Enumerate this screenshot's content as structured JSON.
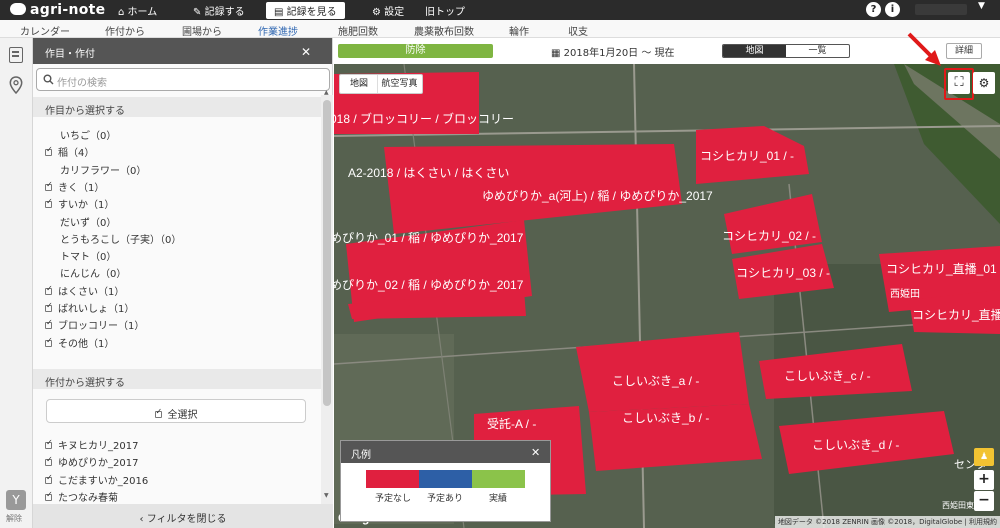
{
  "app": {
    "name": "agri-note"
  },
  "topnav": {
    "home": "ホーム",
    "record": "記録する",
    "view_record": "記録を見る",
    "settings": "設定",
    "legacy": "旧トップ",
    "help": "?",
    "info": "i"
  },
  "tabs": [
    "カレンダー",
    "作付から",
    "圃場から",
    "作業進捗",
    "施肥回数",
    "農薬散布回数",
    "輪作",
    "収支"
  ],
  "active_tab": "作業進捗",
  "panel": {
    "title": "作目・作付",
    "search_placeholder": "作付の検索",
    "crops_section": "作目から選択する",
    "crops": [
      {
        "label": "いちご（0）",
        "checked": false
      },
      {
        "label": "稲（4）",
        "checked": true
      },
      {
        "label": "カリフラワー（0）",
        "checked": false
      },
      {
        "label": "きく（1）",
        "checked": true
      },
      {
        "label": "すいか（1）",
        "checked": true
      },
      {
        "label": "だいず（0）",
        "checked": false
      },
      {
        "label": "とうもろこし（子実）（0）",
        "checked": false
      },
      {
        "label": "トマト（0）",
        "checked": false
      },
      {
        "label": "にんじん（0）",
        "checked": false
      },
      {
        "label": "はくさい（1）",
        "checked": true
      },
      {
        "label": "ばれいしょ（1）",
        "checked": true
      },
      {
        "label": "ブロッコリー（1）",
        "checked": true
      },
      {
        "label": "その他（1）",
        "checked": true
      }
    ],
    "plantings_section": "作付から選択する",
    "select_all": "全選択",
    "plantings": [
      {
        "label": "キヌヒカリ_2017",
        "checked": true
      },
      {
        "label": "ゆめぴりか_2017",
        "checked": true
      },
      {
        "label": "こだますいか_2016",
        "checked": true
      },
      {
        "label": "たつなみ春菊",
        "checked": true
      }
    ],
    "close_filter": "フィルタを閉じる",
    "release": "解除"
  },
  "toolbar": {
    "status": "防除",
    "date_range": "2018年1月20日 〜 現在",
    "view_map": "地図",
    "view_list": "一覧",
    "detail": "詳細"
  },
  "map": {
    "type_map": "地図",
    "type_aerial": "航空写真",
    "fields": [
      "018 / ブロッコリー / ブロッコリー",
      "A2-2018 / はくさい / はくさい",
      "ゆめぴりか_a(河上) / 稲 / ゆめぴりか_2017",
      "めぴりか_01 / 稲 / ゆめぴりか_2017",
      "めぴりか_02 / 稲 / ゆめぴりか_2017",
      "コシヒカリ_01 / -",
      "コシヒカリ_02 / -",
      "コシヒカリ_03 / -",
      "コシヒカリ_直播_01",
      "コシヒカリ_直播",
      "こしいぶき_a / -",
      "こしいぶき_b / -",
      "こしいぶき_c / -",
      "こしいぶき_d / -",
      "受託-A / -"
    ],
    "place_labels": [
      "西姫田",
      "西姫田東",
      "センタ"
    ],
    "google": "Google",
    "attribution": "地図データ ©2018 ZENRIN 画像 ©2018，DigitalGlobe | 利用規約"
  },
  "legend": {
    "title": "凡例",
    "items": [
      {
        "label": "予定なし",
        "color": "#e0203f"
      },
      {
        "label": "予定あり",
        "color": "#2d5fa6"
      },
      {
        "label": "実績",
        "color": "#8bc34a"
      }
    ]
  },
  "colors": {
    "field": "#e0203f",
    "accent": "#2e66b1",
    "status": "#7fb542"
  }
}
